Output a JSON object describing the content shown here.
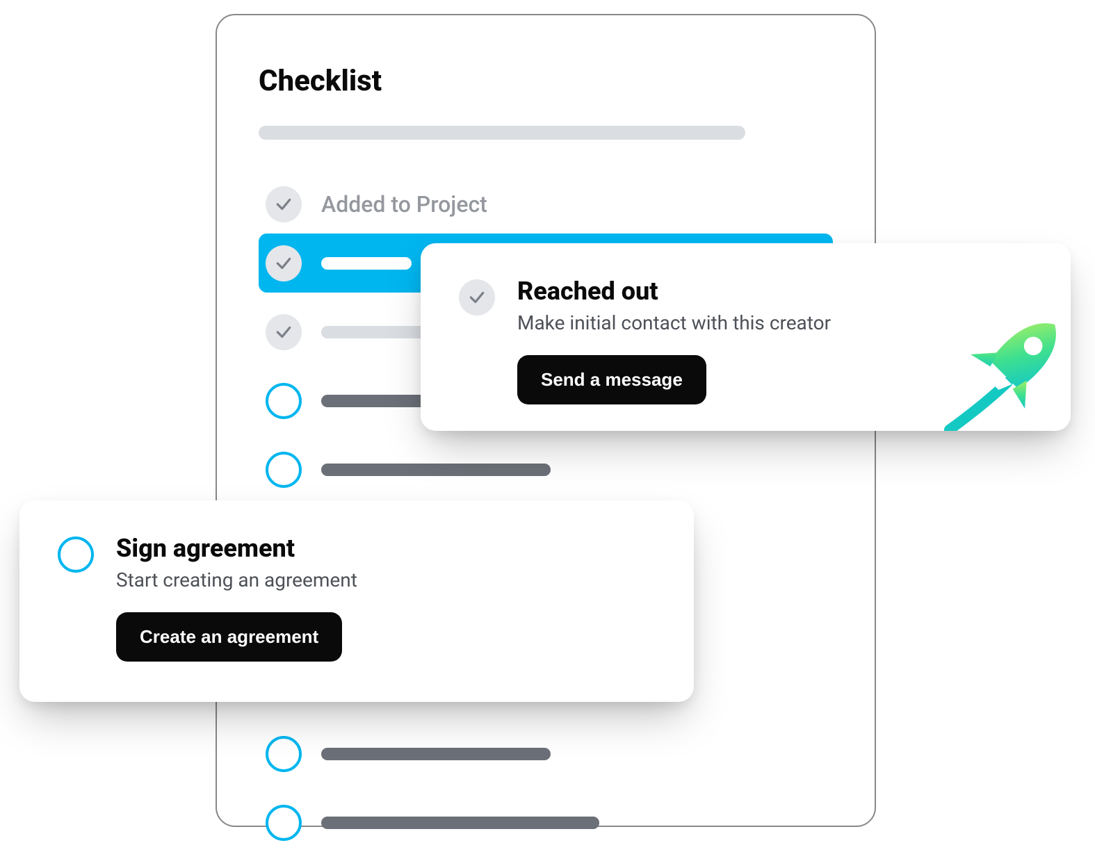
{
  "checklist": {
    "title": "Checklist",
    "items": [
      {
        "label": "Added to Project",
        "state": "completed"
      },
      {
        "state": "active"
      },
      {
        "state": "completed"
      },
      {
        "state": "open"
      },
      {
        "state": "open"
      },
      {
        "state": "open"
      },
      {
        "state": "open"
      },
      {
        "state": "open"
      }
    ]
  },
  "detail_reached": {
    "title": "Reached out",
    "subtitle": "Make initial contact with this creator",
    "button_label": "Send a message"
  },
  "detail_sign": {
    "title": "Sign agreement",
    "subtitle": "Start creating an agreement",
    "button_label": "Create an agreement"
  },
  "colors": {
    "accent": "#00b6ef",
    "button": "#0a0a0a"
  }
}
